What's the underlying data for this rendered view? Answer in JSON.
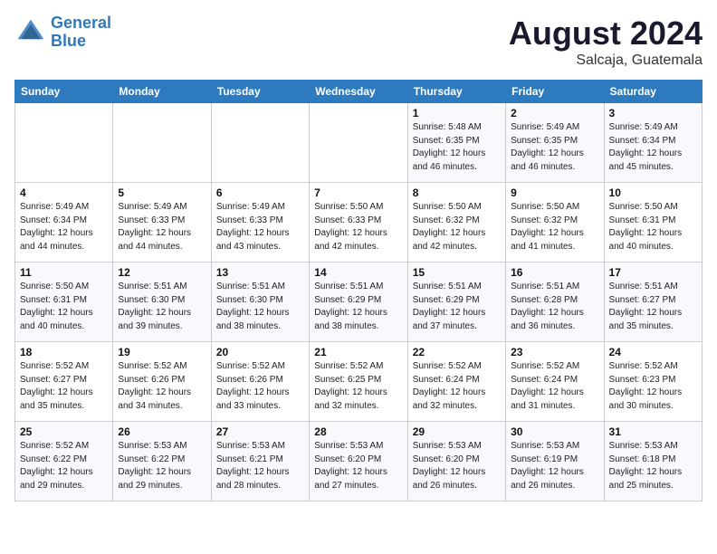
{
  "header": {
    "logo_line1": "General",
    "logo_line2": "Blue",
    "month": "August 2024",
    "location": "Salcaja, Guatemala"
  },
  "weekdays": [
    "Sunday",
    "Monday",
    "Tuesday",
    "Wednesday",
    "Thursday",
    "Friday",
    "Saturday"
  ],
  "weeks": [
    [
      {
        "day": "",
        "info": ""
      },
      {
        "day": "",
        "info": ""
      },
      {
        "day": "",
        "info": ""
      },
      {
        "day": "",
        "info": ""
      },
      {
        "day": "1",
        "info": "Sunrise: 5:48 AM\nSunset: 6:35 PM\nDaylight: 12 hours\nand 46 minutes."
      },
      {
        "day": "2",
        "info": "Sunrise: 5:49 AM\nSunset: 6:35 PM\nDaylight: 12 hours\nand 46 minutes."
      },
      {
        "day": "3",
        "info": "Sunrise: 5:49 AM\nSunset: 6:34 PM\nDaylight: 12 hours\nand 45 minutes."
      }
    ],
    [
      {
        "day": "4",
        "info": "Sunrise: 5:49 AM\nSunset: 6:34 PM\nDaylight: 12 hours\nand 44 minutes."
      },
      {
        "day": "5",
        "info": "Sunrise: 5:49 AM\nSunset: 6:33 PM\nDaylight: 12 hours\nand 44 minutes."
      },
      {
        "day": "6",
        "info": "Sunrise: 5:49 AM\nSunset: 6:33 PM\nDaylight: 12 hours\nand 43 minutes."
      },
      {
        "day": "7",
        "info": "Sunrise: 5:50 AM\nSunset: 6:33 PM\nDaylight: 12 hours\nand 42 minutes."
      },
      {
        "day": "8",
        "info": "Sunrise: 5:50 AM\nSunset: 6:32 PM\nDaylight: 12 hours\nand 42 minutes."
      },
      {
        "day": "9",
        "info": "Sunrise: 5:50 AM\nSunset: 6:32 PM\nDaylight: 12 hours\nand 41 minutes."
      },
      {
        "day": "10",
        "info": "Sunrise: 5:50 AM\nSunset: 6:31 PM\nDaylight: 12 hours\nand 40 minutes."
      }
    ],
    [
      {
        "day": "11",
        "info": "Sunrise: 5:50 AM\nSunset: 6:31 PM\nDaylight: 12 hours\nand 40 minutes."
      },
      {
        "day": "12",
        "info": "Sunrise: 5:51 AM\nSunset: 6:30 PM\nDaylight: 12 hours\nand 39 minutes."
      },
      {
        "day": "13",
        "info": "Sunrise: 5:51 AM\nSunset: 6:30 PM\nDaylight: 12 hours\nand 38 minutes."
      },
      {
        "day": "14",
        "info": "Sunrise: 5:51 AM\nSunset: 6:29 PM\nDaylight: 12 hours\nand 38 minutes."
      },
      {
        "day": "15",
        "info": "Sunrise: 5:51 AM\nSunset: 6:29 PM\nDaylight: 12 hours\nand 37 minutes."
      },
      {
        "day": "16",
        "info": "Sunrise: 5:51 AM\nSunset: 6:28 PM\nDaylight: 12 hours\nand 36 minutes."
      },
      {
        "day": "17",
        "info": "Sunrise: 5:51 AM\nSunset: 6:27 PM\nDaylight: 12 hours\nand 35 minutes."
      }
    ],
    [
      {
        "day": "18",
        "info": "Sunrise: 5:52 AM\nSunset: 6:27 PM\nDaylight: 12 hours\nand 35 minutes."
      },
      {
        "day": "19",
        "info": "Sunrise: 5:52 AM\nSunset: 6:26 PM\nDaylight: 12 hours\nand 34 minutes."
      },
      {
        "day": "20",
        "info": "Sunrise: 5:52 AM\nSunset: 6:26 PM\nDaylight: 12 hours\nand 33 minutes."
      },
      {
        "day": "21",
        "info": "Sunrise: 5:52 AM\nSunset: 6:25 PM\nDaylight: 12 hours\nand 32 minutes."
      },
      {
        "day": "22",
        "info": "Sunrise: 5:52 AM\nSunset: 6:24 PM\nDaylight: 12 hours\nand 32 minutes."
      },
      {
        "day": "23",
        "info": "Sunrise: 5:52 AM\nSunset: 6:24 PM\nDaylight: 12 hours\nand 31 minutes."
      },
      {
        "day": "24",
        "info": "Sunrise: 5:52 AM\nSunset: 6:23 PM\nDaylight: 12 hours\nand 30 minutes."
      }
    ],
    [
      {
        "day": "25",
        "info": "Sunrise: 5:52 AM\nSunset: 6:22 PM\nDaylight: 12 hours\nand 29 minutes."
      },
      {
        "day": "26",
        "info": "Sunrise: 5:53 AM\nSunset: 6:22 PM\nDaylight: 12 hours\nand 29 minutes."
      },
      {
        "day": "27",
        "info": "Sunrise: 5:53 AM\nSunset: 6:21 PM\nDaylight: 12 hours\nand 28 minutes."
      },
      {
        "day": "28",
        "info": "Sunrise: 5:53 AM\nSunset: 6:20 PM\nDaylight: 12 hours\nand 27 minutes."
      },
      {
        "day": "29",
        "info": "Sunrise: 5:53 AM\nSunset: 6:20 PM\nDaylight: 12 hours\nand 26 minutes."
      },
      {
        "day": "30",
        "info": "Sunrise: 5:53 AM\nSunset: 6:19 PM\nDaylight: 12 hours\nand 26 minutes."
      },
      {
        "day": "31",
        "info": "Sunrise: 5:53 AM\nSunset: 6:18 PM\nDaylight: 12 hours\nand 25 minutes."
      }
    ]
  ]
}
